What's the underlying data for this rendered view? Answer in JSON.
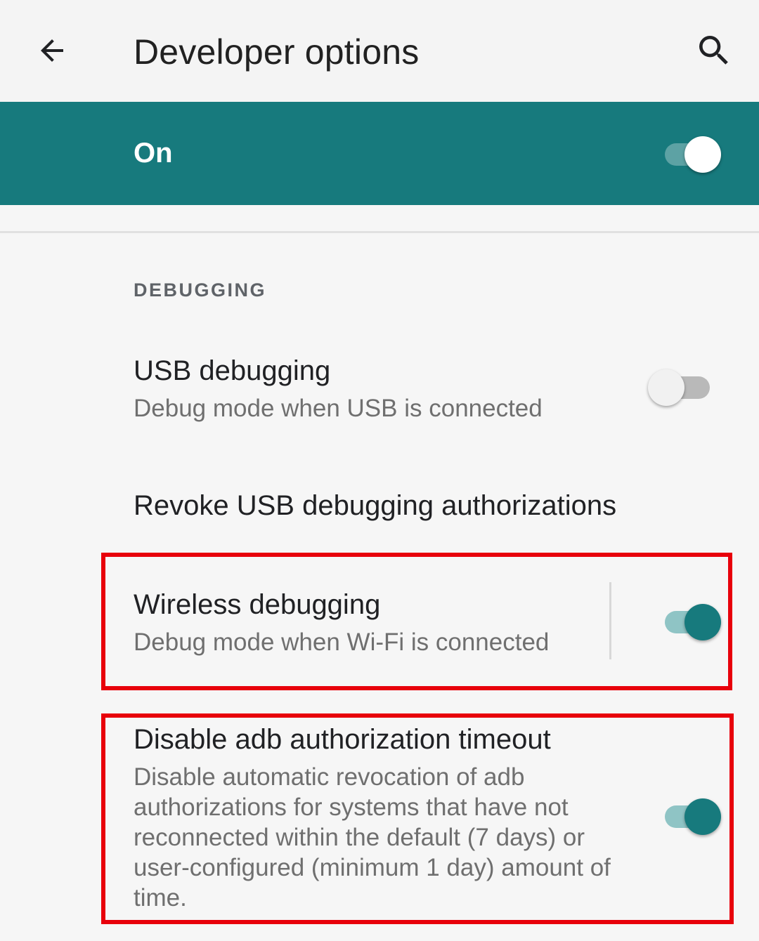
{
  "appbar": {
    "title": "Developer options",
    "back_icon": "arrow-back-icon",
    "search_icon": "search-icon"
  },
  "master_switch": {
    "label": "On",
    "checked": true
  },
  "section": {
    "header": "DEBUGGING"
  },
  "preferences": [
    {
      "title": "USB debugging",
      "summary": "Debug mode when USB is connected",
      "checked": false
    },
    {
      "title": "Revoke USB debugging authorizations"
    },
    {
      "title": "Wireless debugging",
      "summary": "Debug mode when Wi-Fi is connected",
      "checked": true
    },
    {
      "title": "Disable adb authorization timeout",
      "summary": "Disable automatic revocation of adb authorizations for systems that have not reconnected within the default (7 days) or user-configured (minimum 1 day) amount of time.",
      "checked": true
    }
  ],
  "colors": {
    "accent": "#177a7d",
    "highlight": "#e8000b",
    "background": "#f6f6f6"
  }
}
